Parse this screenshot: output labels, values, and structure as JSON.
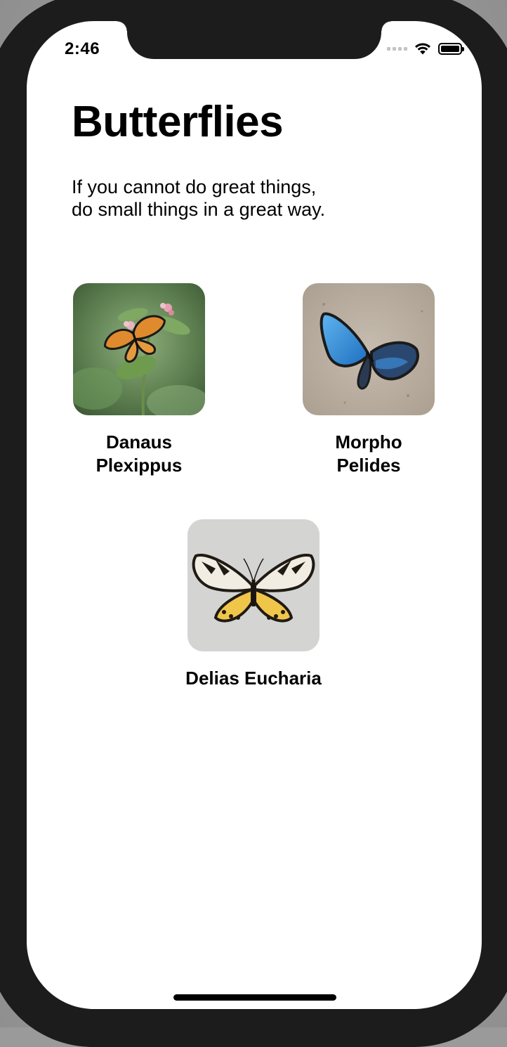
{
  "status_bar": {
    "time": "2:46",
    "signal_icon": "cellular-signal-dots",
    "wifi_icon": "wifi-icon",
    "battery_icon": "battery-icon",
    "battery_level": 1.0
  },
  "page": {
    "title": "Butterflies",
    "subtitle_line1": "If you cannot do great things,",
    "subtitle_line2": "do small things in a great way."
  },
  "butterflies": [
    {
      "name_line1": "Danaus",
      "name_line2": "Plexippus",
      "image": "monarch-butterfly-on-flower"
    },
    {
      "name_line1": "Morpho",
      "name_line2": "Pelides",
      "image": "blue-morpho-butterfly-on-sand"
    },
    {
      "name_line1": "Delias Eucharia",
      "name_line2": "",
      "image": "yellow-black-butterfly-on-white"
    }
  ],
  "colors": {
    "background": "#ffffff",
    "text": "#000000",
    "bezel": "#1c1c1c"
  }
}
